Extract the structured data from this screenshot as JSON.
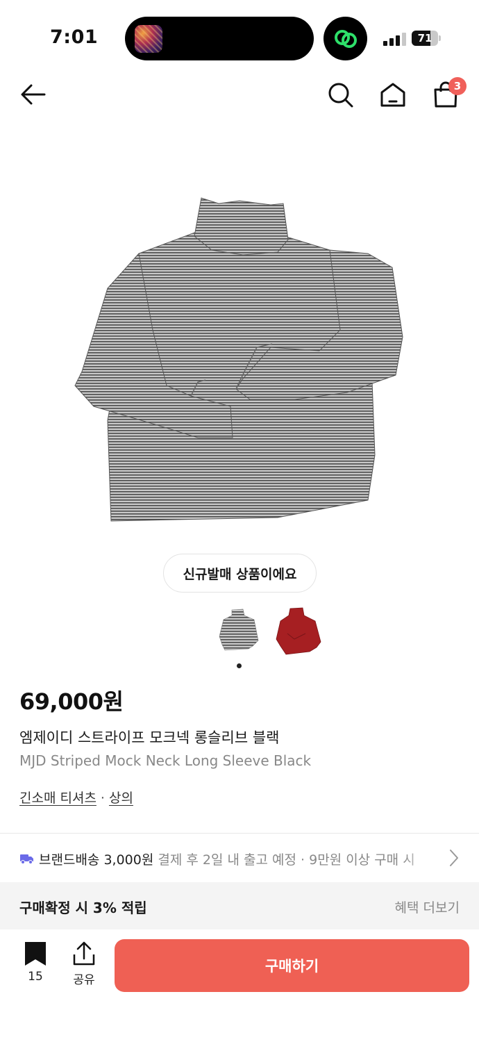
{
  "status_bar": {
    "time": "7:01",
    "battery": "71",
    "battery_level": 0.71,
    "signal_bars_active": 3
  },
  "nav": {
    "back_icon": "arrow-left-icon",
    "search_icon": "search-icon",
    "home_icon": "home-icon",
    "cart_icon": "shopping-bag-icon",
    "cart_count": "3"
  },
  "product": {
    "new_release_label": "신규발매 상품이에요",
    "colorways": [
      "grey-stripe",
      "red"
    ],
    "price": "69,000원",
    "name_ko": "엠제이디 스트라이프 모크넥 롱슬리브 블랙",
    "name_en": "MJD Striped Mock Neck Long Sleeve Black",
    "categories": [
      "긴소매 티셔츠",
      "상의"
    ],
    "category_separator": "·"
  },
  "shipping": {
    "icon": "truck-icon",
    "label": "브랜드배송",
    "fee": "3,000원",
    "info": "결제 후 2일 내 출고 예정 · 9만원 이상 구매 시"
  },
  "points": {
    "label": "구매확정 시 3% 적립",
    "more": "혜택 더보기"
  },
  "bottom_bar": {
    "save_count": "15",
    "share_label": "공유",
    "buy_label": "구매하기"
  },
  "colors": {
    "accent": "#ef6054",
    "badge": "#f0605a",
    "shipping_icon": "#6a6ae8"
  }
}
